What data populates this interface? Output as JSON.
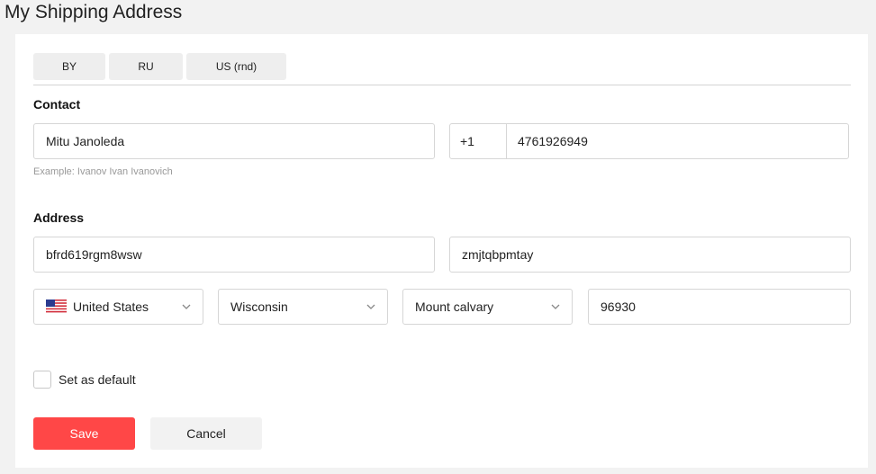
{
  "page": {
    "title": "My Shipping Address"
  },
  "tabs": [
    {
      "label": "BY"
    },
    {
      "label": "RU"
    },
    {
      "label": "US (rnd)"
    }
  ],
  "contact": {
    "heading": "Contact",
    "name_value": "Mitu Janoleda",
    "name_hint": "Example: Ivanov Ivan Ivanovich",
    "phone_code": "+1",
    "phone_number": "4761926949"
  },
  "address": {
    "heading": "Address",
    "street_value": "bfrd619rgm8wsw",
    "street2_value": "zmjtqbpmtay",
    "country": {
      "value": "United States",
      "flag_icon": "us-flag-icon"
    },
    "state": {
      "value": "Wisconsin"
    },
    "city": {
      "value": "Mount calvary"
    },
    "zip_value": "96930"
  },
  "default_checkbox": {
    "label": "Set as default",
    "checked": false
  },
  "actions": {
    "save_label": "Save",
    "cancel_label": "Cancel"
  },
  "colors": {
    "save_bg": "#ff4747",
    "tab_bg": "#eeeeee",
    "page_bg": "#f2f2f2"
  }
}
